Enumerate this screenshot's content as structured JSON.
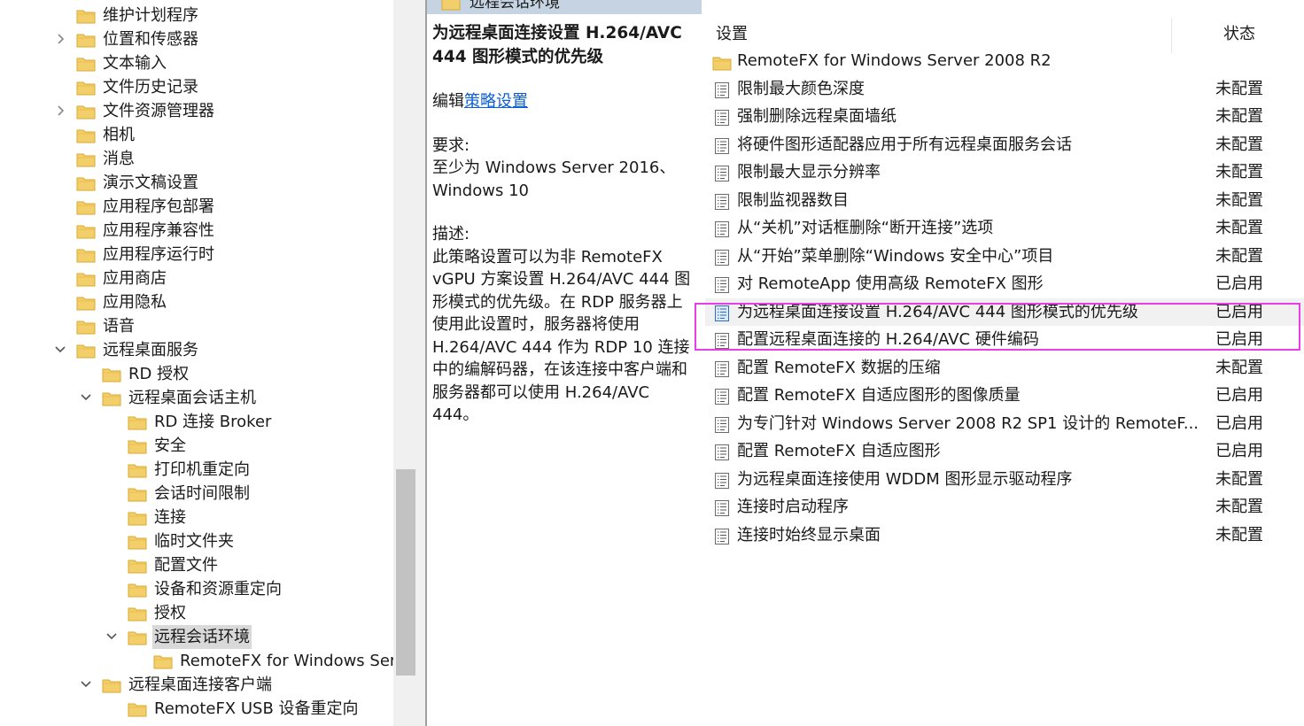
{
  "tree": {
    "items": [
      {
        "label": "维护计划程序",
        "expander": ""
      },
      {
        "label": "位置和传感器",
        "expander": "collapsed"
      },
      {
        "label": "文本输入",
        "expander": ""
      },
      {
        "label": "文件历史记录",
        "expander": ""
      },
      {
        "label": "文件资源管理器",
        "expander": "collapsed"
      },
      {
        "label": "相机",
        "expander": ""
      },
      {
        "label": "消息",
        "expander": ""
      },
      {
        "label": "演示文稿设置",
        "expander": ""
      },
      {
        "label": "应用程序包部署",
        "expander": ""
      },
      {
        "label": "应用程序兼容性",
        "expander": ""
      },
      {
        "label": "应用程序运行时",
        "expander": ""
      },
      {
        "label": "应用商店",
        "expander": ""
      },
      {
        "label": "应用隐私",
        "expander": ""
      },
      {
        "label": "语音",
        "expander": ""
      },
      {
        "label": "远程桌面服务",
        "expander": "expanded"
      },
      {
        "label": "RD 授权",
        "expander": ""
      },
      {
        "label": "远程桌面会话主机",
        "expander": "expanded"
      },
      {
        "label": "RD 连接 Broker",
        "expander": ""
      },
      {
        "label": "安全",
        "expander": ""
      },
      {
        "label": "打印机重定向",
        "expander": ""
      },
      {
        "label": "会话时间限制",
        "expander": ""
      },
      {
        "label": "连接",
        "expander": ""
      },
      {
        "label": "临时文件夹",
        "expander": ""
      },
      {
        "label": "配置文件",
        "expander": ""
      },
      {
        "label": "设备和资源重定向",
        "expander": ""
      },
      {
        "label": "授权",
        "expander": ""
      },
      {
        "label": "远程会话环境",
        "expander": "expanded",
        "selected": true
      },
      {
        "label": "RemoteFX for Windows Serve",
        "expander": ""
      },
      {
        "label": "远程桌面连接客户端",
        "expander": "expanded"
      },
      {
        "label": "RemoteFX USB 设备重定向",
        "expander": ""
      }
    ]
  },
  "header": {
    "title": "远程会话环境"
  },
  "description": {
    "title": "为远程桌面连接设置 H.264/AVC 444 图形模式的优先级",
    "edit_prefix": "编辑",
    "edit_link": "策略设置",
    "requirements_label": "要求:",
    "requirements_text": "至少为 Windows Server 2016、Windows 10",
    "description_label": "描述:",
    "description_text": "此策略设置可以为非 RemoteFX vGPU 方案设置 H.264/AVC 444 图形模式的优先级。在 RDP 服务器上使用此设置时，服务器将使用 H.264/AVC 444 作为 RDP 10 连接中的编解码器，在该连接中客户端和服务器都可以使用 H.264/AVC 444。"
  },
  "list": {
    "columns": {
      "setting": "设置",
      "state": "状态"
    },
    "rows": [
      {
        "name": "RemoteFX for Windows Server 2008 R2",
        "state": "",
        "icon": "folder-icon"
      },
      {
        "name": "限制最大颜色深度",
        "state": "未配置",
        "icon": "policy-icon"
      },
      {
        "name": "强制删除远程桌面墙纸",
        "state": "未配置",
        "icon": "policy-icon"
      },
      {
        "name": "将硬件图形适配器应用于所有远程桌面服务会话",
        "state": "未配置",
        "icon": "policy-icon"
      },
      {
        "name": "限制最大显示分辨率",
        "state": "未配置",
        "icon": "policy-icon"
      },
      {
        "name": "限制监视器数目",
        "state": "未配置",
        "icon": "policy-icon"
      },
      {
        "name": "从“关机”对话框删除“断开连接”选项",
        "state": "未配置",
        "icon": "policy-icon"
      },
      {
        "name": "从“开始”菜单删除“Windows 安全中心”项目",
        "state": "未配置",
        "icon": "policy-icon"
      },
      {
        "name": "对 RemoteApp 使用高级 RemoteFX 图形",
        "state": "已启用",
        "icon": "policy-icon"
      },
      {
        "name": "为远程桌面连接设置 H.264/AVC 444 图形模式的优先级",
        "state": "已启用",
        "icon": "policy-icon",
        "selected": true
      },
      {
        "name": "配置远程桌面连接的 H.264/AVC 硬件编码",
        "state": "已启用",
        "icon": "policy-icon"
      },
      {
        "name": "配置 RemoteFX 数据的压缩",
        "state": "未配置",
        "icon": "policy-icon"
      },
      {
        "name": "配置 RemoteFX 自适应图形的图像质量",
        "state": "已启用",
        "icon": "policy-icon"
      },
      {
        "name": "为专门针对 Windows Server 2008 R2 SP1 设计的 RemoteF...",
        "state": "已启用",
        "icon": "policy-icon"
      },
      {
        "name": "配置 RemoteFX 自适应图形",
        "state": "已启用",
        "icon": "policy-icon"
      },
      {
        "name": "为远程桌面连接使用 WDDM 图形显示驱动程序",
        "state": "未配置",
        "icon": "policy-icon"
      },
      {
        "name": "连接时启动程序",
        "state": "未配置",
        "icon": "policy-icon"
      },
      {
        "name": "连接时始终显示桌面",
        "state": "未配置",
        "icon": "policy-icon"
      }
    ]
  },
  "colors": {
    "highlight_border": "#e83ee8",
    "folder": "#f3cf6b",
    "link": "#0b5ed7"
  }
}
